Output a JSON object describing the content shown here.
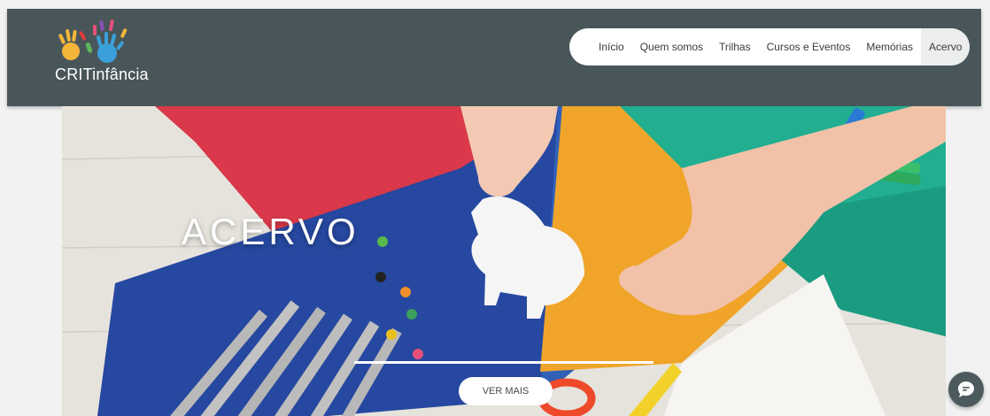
{
  "brand": {
    "logo_text": "CRITinfância"
  },
  "nav": {
    "items": [
      {
        "label": "Início"
      },
      {
        "label": "Quem somos"
      },
      {
        "label": "Trilhas"
      },
      {
        "label": "Cursos e Eventos"
      },
      {
        "label": "Memórias"
      },
      {
        "label": "Acervo",
        "active": true
      }
    ]
  },
  "hero": {
    "title": "ACERVO",
    "cta_label": "VER MAIS"
  },
  "chat": {
    "icon": "chat-bubble-icon"
  },
  "colors": {
    "header_bg": "#495659",
    "chat_bg": "#4d5a5d"
  }
}
